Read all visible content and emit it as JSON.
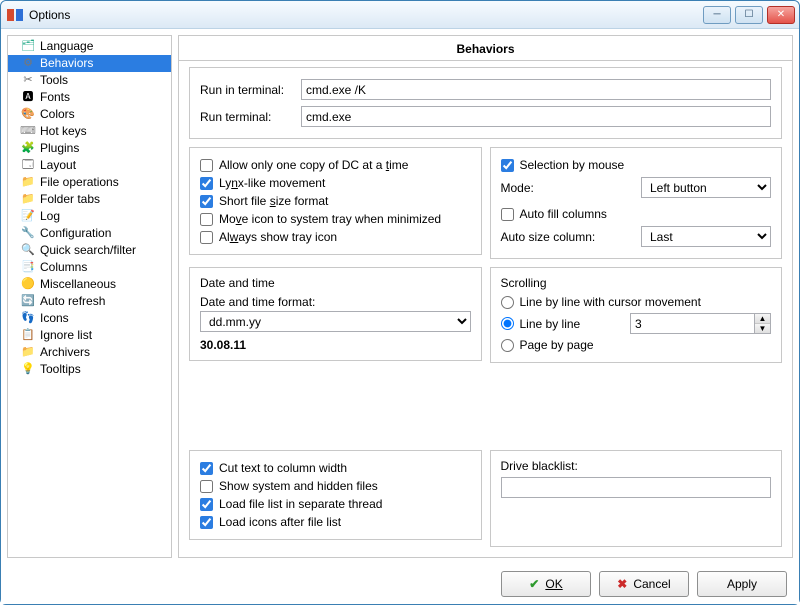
{
  "window": {
    "title": "Options"
  },
  "tree": {
    "items": [
      {
        "label": "Language",
        "icon": "lang",
        "selected": false
      },
      {
        "label": "Behaviors",
        "icon": "gear",
        "selected": true
      },
      {
        "label": "Tools",
        "icon": "scissors",
        "selected": false
      },
      {
        "label": "Fonts",
        "icon": "font",
        "selected": false
      },
      {
        "label": "Colors",
        "icon": "palette",
        "selected": false
      },
      {
        "label": "Hot keys",
        "icon": "key",
        "selected": false
      },
      {
        "label": "Plugins",
        "icon": "plugin",
        "selected": false
      },
      {
        "label": "Layout",
        "icon": "layout",
        "selected": false
      },
      {
        "label": "File operations",
        "icon": "folder",
        "selected": false
      },
      {
        "label": "Folder tabs",
        "icon": "folder",
        "selected": false
      },
      {
        "label": "Log",
        "icon": "log",
        "selected": false
      },
      {
        "label": "Configuration",
        "icon": "wrench",
        "selected": false
      },
      {
        "label": "Quick search/filter",
        "icon": "search",
        "selected": false
      },
      {
        "label": "Columns",
        "icon": "columns",
        "selected": false
      },
      {
        "label": "Miscellaneous",
        "icon": "misc",
        "selected": false
      },
      {
        "label": "Auto refresh",
        "icon": "refresh",
        "selected": false
      },
      {
        "label": "Icons",
        "icon": "icons",
        "selected": false
      },
      {
        "label": "Ignore list",
        "icon": "ignore",
        "selected": false
      },
      {
        "label": "Archivers",
        "icon": "archive",
        "selected": false
      },
      {
        "label": "Tooltips",
        "icon": "tip",
        "selected": false
      }
    ]
  },
  "page": {
    "title": "Behaviors",
    "terminal": {
      "run_in_label": "Run in terminal:",
      "run_in_value": "cmd.exe /K",
      "run_label": "Run terminal:",
      "run_value": "cmd.exe"
    },
    "left_checks": {
      "one_copy": {
        "label_pre": "Allow only one copy of DC at a ",
        "u": "t",
        "label_post": "ime",
        "checked": false
      },
      "lynx": {
        "label_pre": "Ly",
        "u": "n",
        "label_post": "x-like movement",
        "checked": true
      },
      "short_size": {
        "label_pre": "Short file ",
        "u": "s",
        "label_post": "ize format",
        "checked": true
      },
      "tray_min": {
        "label_pre": "Mo",
        "u": "v",
        "label_post": "e icon to system tray when minimized",
        "checked": false
      },
      "tray_always": {
        "label_pre": "Al",
        "u": "w",
        "label_post": "ays show tray icon",
        "checked": false
      }
    },
    "right_top": {
      "sel_mouse": {
        "label": "Selection by mouse",
        "checked": true
      },
      "mode_label": "Mode:",
      "mode_value": "Left button",
      "auto_fill": {
        "label": "Auto fill columns",
        "checked": false
      },
      "auto_size_label": "Auto size column:",
      "auto_size_value": "Last"
    },
    "datetime": {
      "title": "Date and time",
      "format_label": "Date and time format:",
      "format_value": "dd.mm.yy",
      "sample": "30.08.11"
    },
    "scrolling": {
      "title": "Scrolling",
      "line_cursor": "Line by line with cursor movement",
      "line_by_line": "Line by line",
      "line_value": "3",
      "page": "Page by page",
      "selected": "line_by_line"
    },
    "bottom_left": {
      "cut": {
        "label": "Cut text to column width",
        "checked": true
      },
      "show_hidden": {
        "label": "Show system and hidden files",
        "checked": false
      },
      "sep_thread": {
        "label": "Load file list in separate thread",
        "checked": true
      },
      "icons_after": {
        "label": "Load icons after file list",
        "checked": true
      }
    },
    "blacklist": {
      "label": "Drive blacklist:",
      "value": ""
    }
  },
  "buttons": {
    "ok": "OK",
    "cancel": "Cancel",
    "apply": "Apply"
  }
}
